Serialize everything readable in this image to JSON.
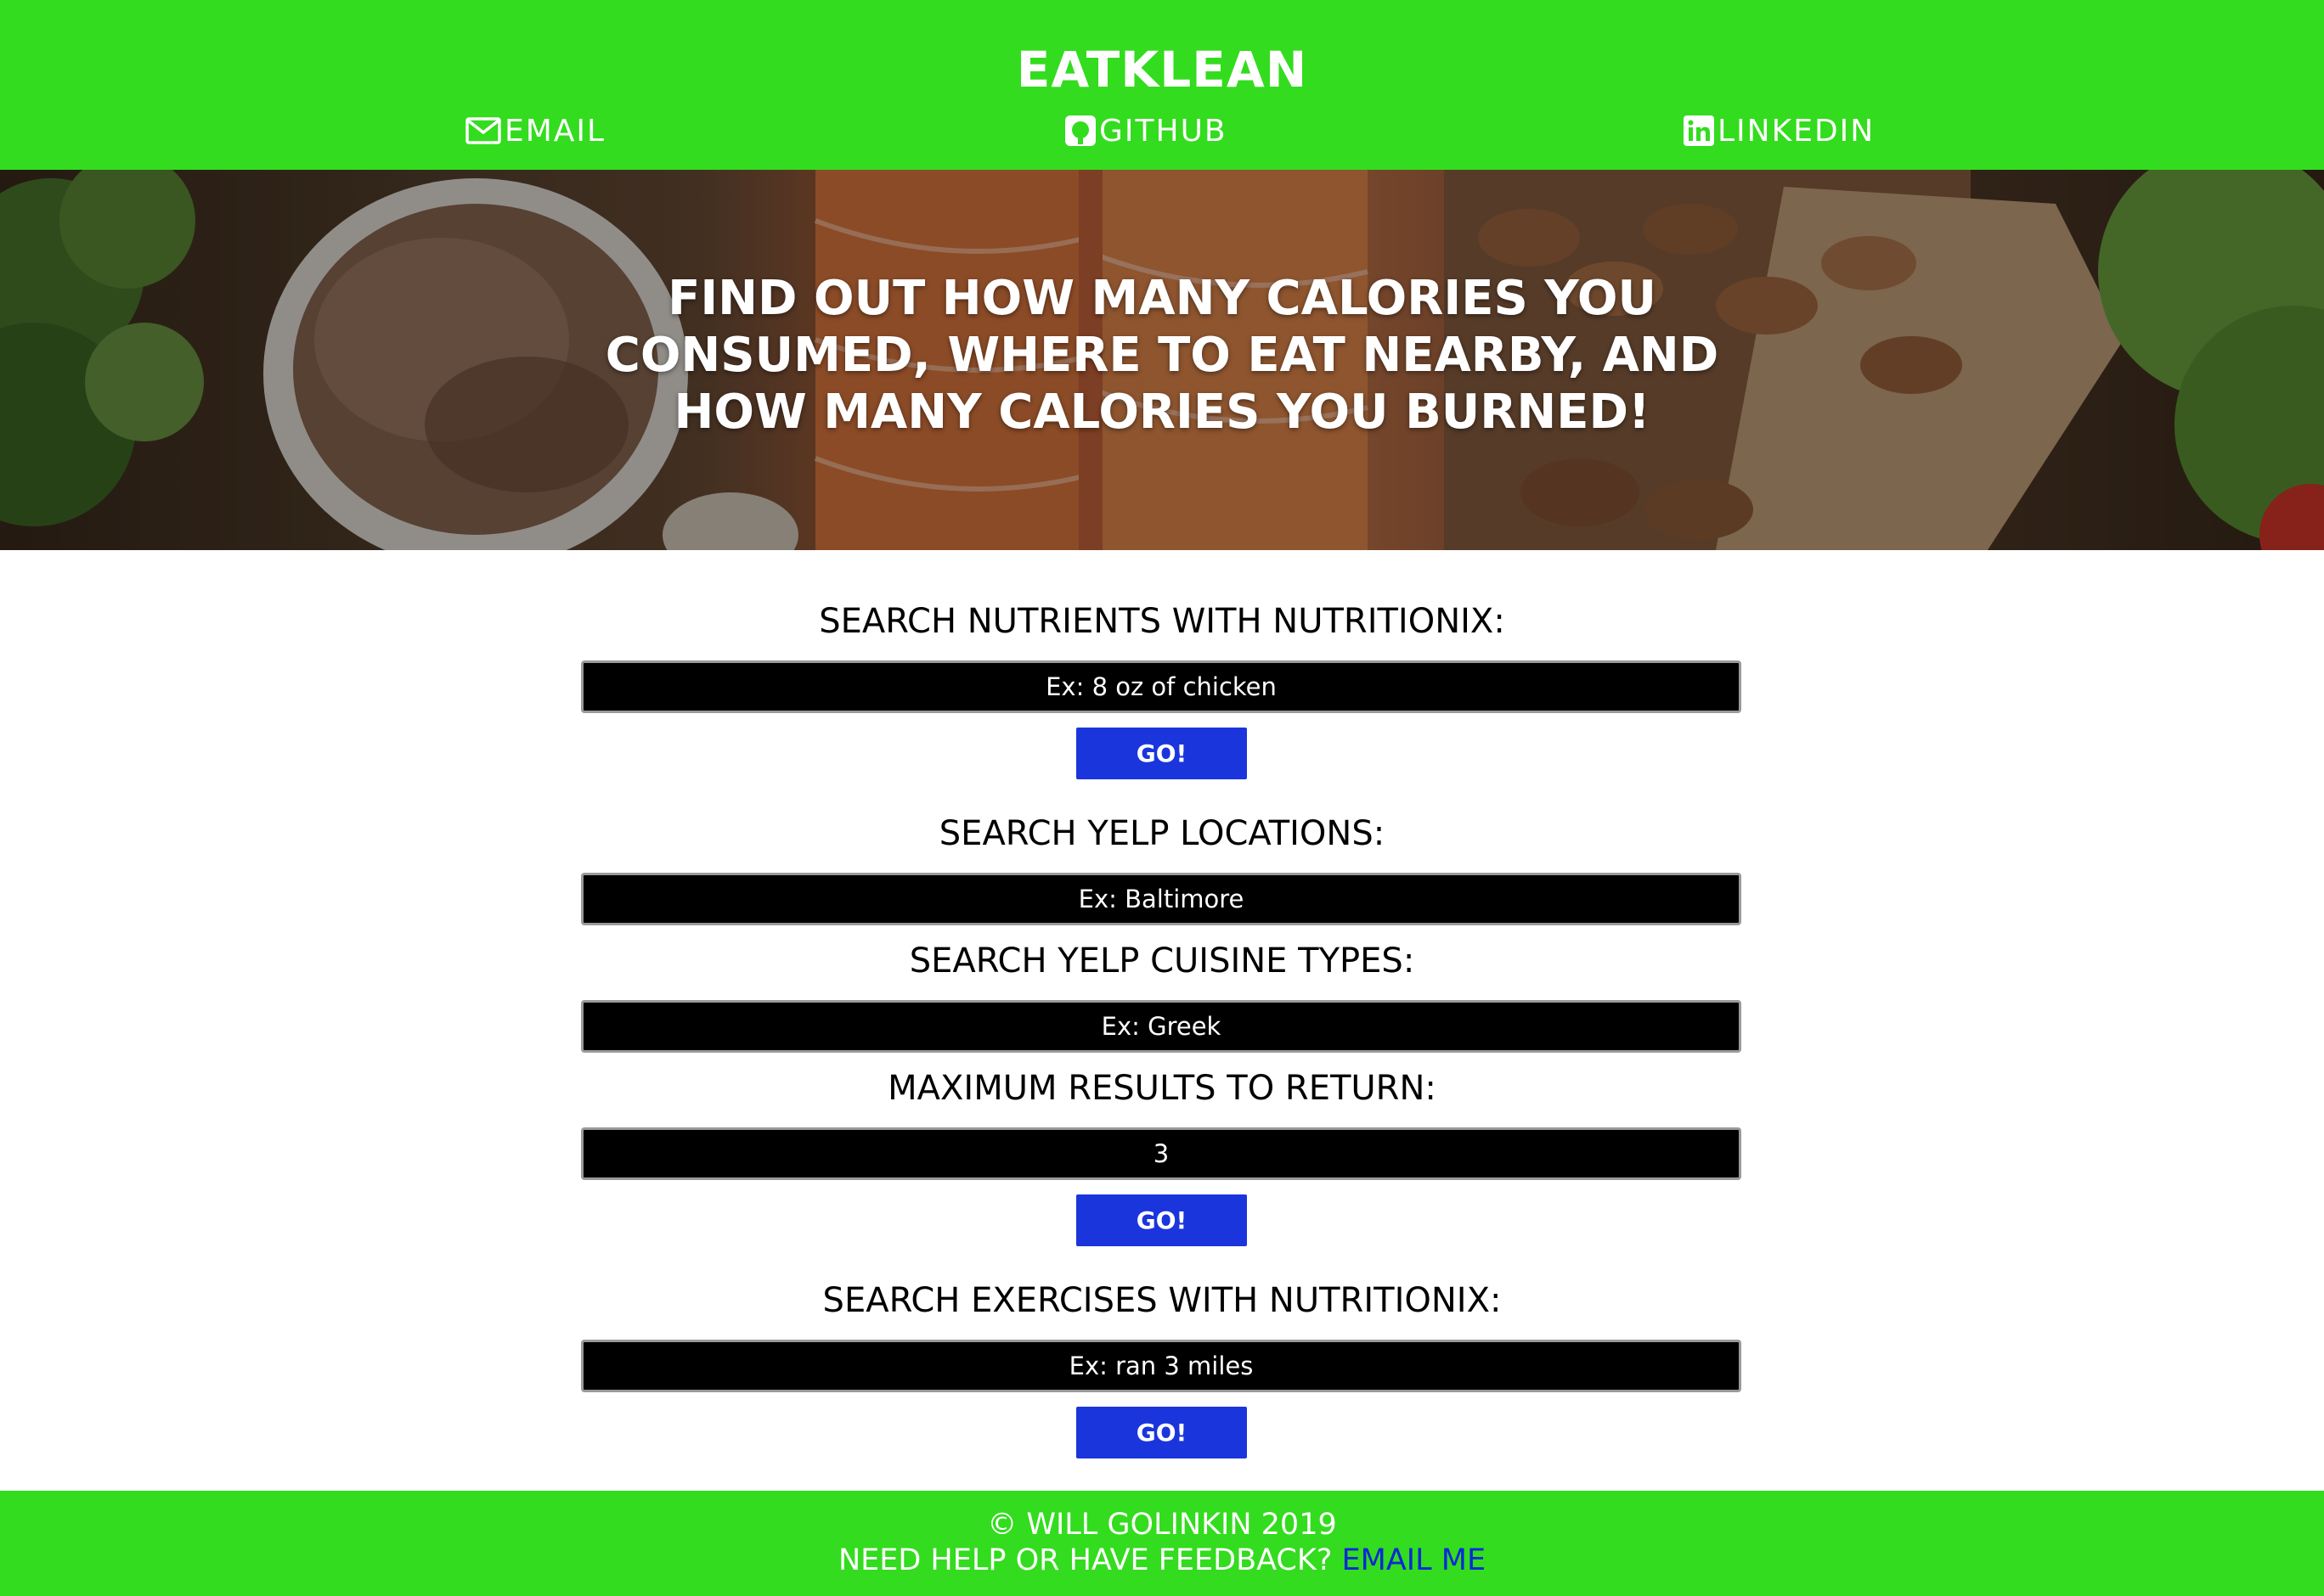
{
  "header": {
    "brand": "EATKLEAN",
    "nav": {
      "email": {
        "label": "EMAIL",
        "icon": "envelope-icon"
      },
      "github": {
        "label": "GITHUB",
        "icon": "github-icon"
      },
      "linkedin": {
        "label": "LINKEDIN",
        "icon": "linkedin-icon"
      }
    }
  },
  "hero": {
    "text": "FIND OUT HOW MANY CALORIES YOU CONSUMED, WHERE TO EAT NEARBY, AND HOW MANY CALORIES YOU BURNED!"
  },
  "nutrients": {
    "heading": "SEARCH NUTRIENTS WITH NUTRITIONIX:",
    "placeholder": "Ex: 8 oz of chicken",
    "button": "GO!"
  },
  "yelp": {
    "location_heading": "SEARCH YELP LOCATIONS:",
    "location_placeholder": "Ex: Baltimore",
    "cuisine_heading": "SEARCH YELP CUISINE TYPES:",
    "cuisine_placeholder": "Ex: Greek",
    "max_heading": "MAXIMUM RESULTS TO RETURN:",
    "max_value": "3",
    "button": "GO!"
  },
  "exercises": {
    "heading": "SEARCH EXERCISES WITH NUTRITIONIX:",
    "placeholder": "Ex: ran 3 miles",
    "button": "GO!"
  },
  "footer": {
    "copyright": "© WILL GOLINKIN 2019",
    "help_text": "NEED HELP OR HAVE FEEDBACK?",
    "email_link": "EMAIL ME"
  },
  "colors": {
    "brand_green": "#33dc1e",
    "button_blue": "#1b35dc",
    "link_blue": "#0a28d6",
    "input_bg": "#000000"
  }
}
